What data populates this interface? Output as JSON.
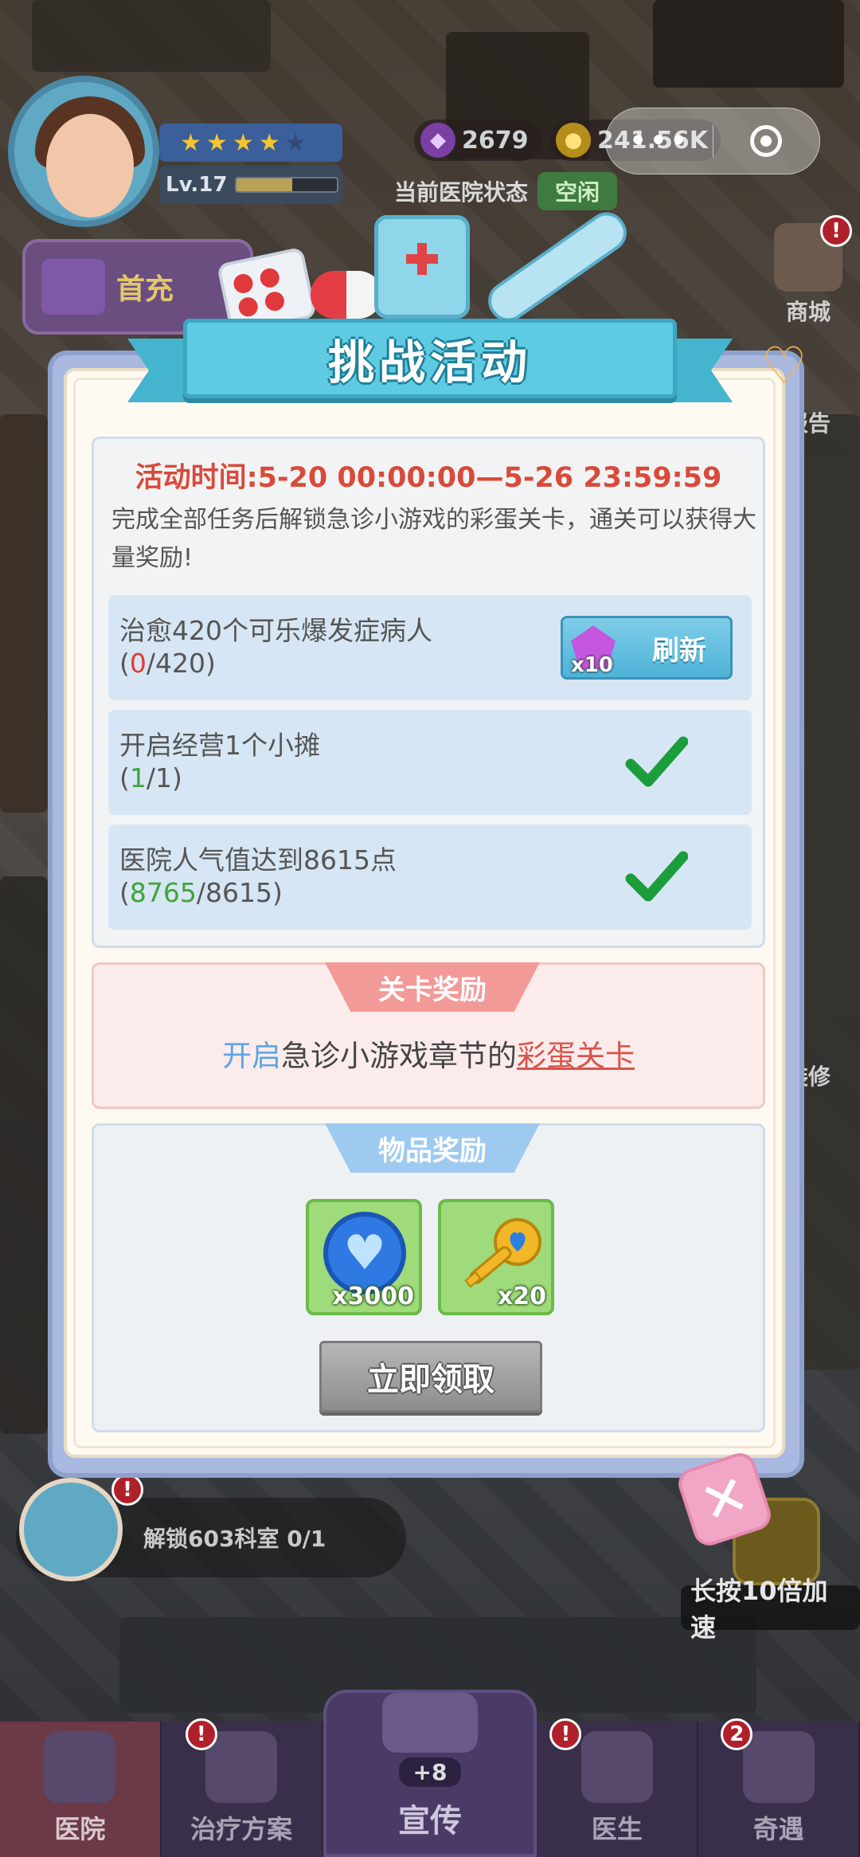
{
  "hud": {
    "level": "Lv.17",
    "level_progress": 0.55,
    "stars_filled": 3.5,
    "stars_total": 5,
    "gems": "2679",
    "coins": "241.56K",
    "hospital_status_label": "当前医院状态",
    "hospital_status_value": "空闲",
    "first_charge_label": "首充",
    "capsule_more": "•••",
    "side_buttons": [
      {
        "label": "商城"
      },
      {
        "label": "报告"
      },
      {
        "label": "装修"
      }
    ]
  },
  "dialog": {
    "title": "挑战活动",
    "event_time": "活动时间:5-20 00:00:00—5-26 23:59:59",
    "description": "完成全部任务后解锁急诊小游戏的彩蛋关卡，通关可以获得大量奖励!",
    "tasks": [
      {
        "title": "治愈420个可乐爆发症病人",
        "current": "0",
        "target": "420",
        "done": false,
        "action_label": "刷新",
        "action_cost": "x10"
      },
      {
        "title": "开启经营1个小摊",
        "current": "1",
        "target": "1",
        "done": true
      },
      {
        "title": "医院人气值达到8615点",
        "current": "8765",
        "target": "8615",
        "done": true
      }
    ],
    "stage_reward_title": "关卡奖励",
    "stage_reward_prefix": "开启",
    "stage_reward_middle": "急诊小游戏章节的",
    "stage_reward_link": "彩蛋关卡",
    "item_reward_title": "物品奖励",
    "items": [
      {
        "icon": "heart-coin-icon",
        "qty": "x3000"
      },
      {
        "icon": "heart-key-icon",
        "qty": "x20"
      }
    ],
    "claim_label": "立即领取"
  },
  "bottom": {
    "task_text": "解锁603科室  0/1",
    "speed_tip": "长按10倍加速",
    "nav": [
      {
        "label": "医院"
      },
      {
        "label": "治疗方案"
      },
      {
        "label": "宣传",
        "plus": "+8"
      },
      {
        "label": "医生"
      },
      {
        "label": "奇遇",
        "badge": "2"
      }
    ]
  }
}
